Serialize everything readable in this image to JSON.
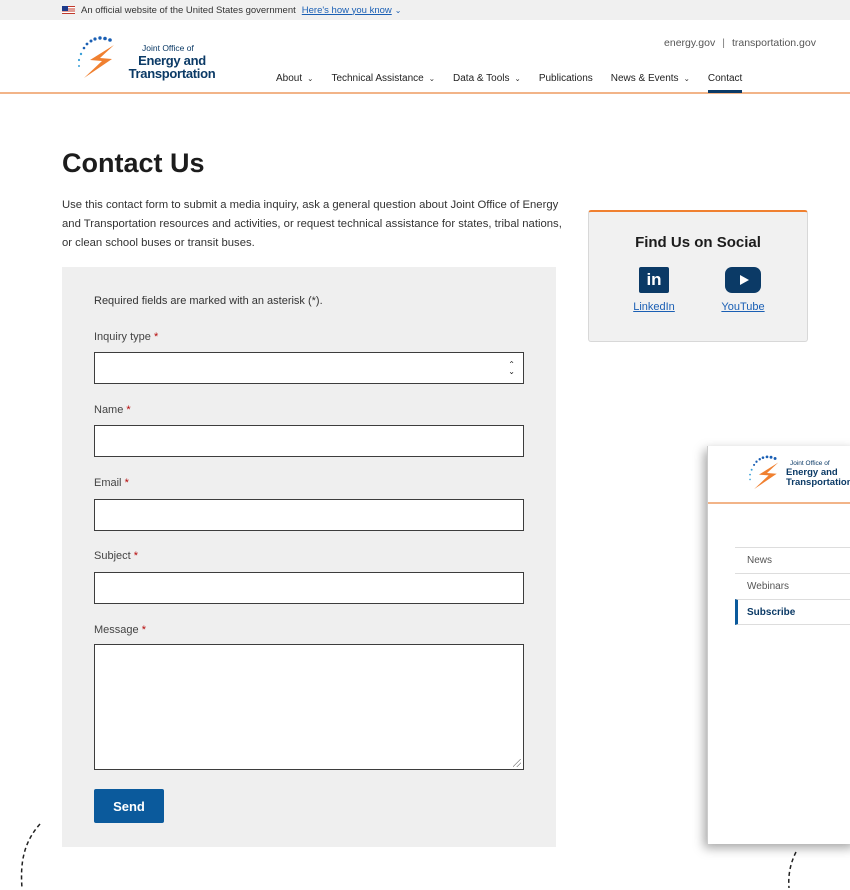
{
  "gov_banner": {
    "text": "An official website of the United States government",
    "link": "Here's how you know"
  },
  "header": {
    "logo_small": "Joint Office of",
    "logo_big_line1": "Energy and",
    "logo_big_line2": "Transportation",
    "util_links": [
      "energy.gov",
      "transportation.gov"
    ],
    "nav": [
      {
        "label": "About",
        "dropdown": true
      },
      {
        "label": "Technical Assistance",
        "dropdown": true
      },
      {
        "label": "Data & Tools",
        "dropdown": true
      },
      {
        "label": "Publications",
        "dropdown": false
      },
      {
        "label": "News & Events",
        "dropdown": true
      },
      {
        "label": "Contact",
        "dropdown": false,
        "active": true
      }
    ]
  },
  "page": {
    "title": "Contact Us",
    "intro": "Use this contact form to submit a media inquiry, ask a general question about Joint Office of Energy and Transportation resources and activities, or request technical assistance for states, tribal nations, or clean school buses or transit buses."
  },
  "form": {
    "required_note": "Required fields are marked with an asterisk (*).",
    "asterisk": "*",
    "fields": {
      "inquiry_type": {
        "label": "Inquiry type",
        "value": ""
      },
      "name": {
        "label": "Name",
        "value": ""
      },
      "email": {
        "label": "Email",
        "value": ""
      },
      "subject": {
        "label": "Subject",
        "value": ""
      },
      "message": {
        "label": "Message",
        "value": ""
      }
    },
    "submit_label": "Send"
  },
  "social": {
    "title": "Find Us on Social",
    "items": [
      {
        "label": "LinkedIn",
        "icon": "linkedin-icon",
        "glyph": "in"
      },
      {
        "label": "YouTube",
        "icon": "youtube-icon"
      }
    ]
  },
  "preview": {
    "logo_small": "Joint Office of",
    "logo_big_line1": "Energy and",
    "logo_big_line2": "Transportation",
    "menu": [
      {
        "label": "News"
      },
      {
        "label": "Webinars"
      },
      {
        "label": "Subscribe",
        "active": true
      }
    ]
  },
  "colors": {
    "brand_navy": "#0b3a66",
    "accent_orange": "#f08030",
    "button_blue": "#0b5a9c",
    "link_blue": "#1a5fb4",
    "required_red": "#b50909"
  }
}
